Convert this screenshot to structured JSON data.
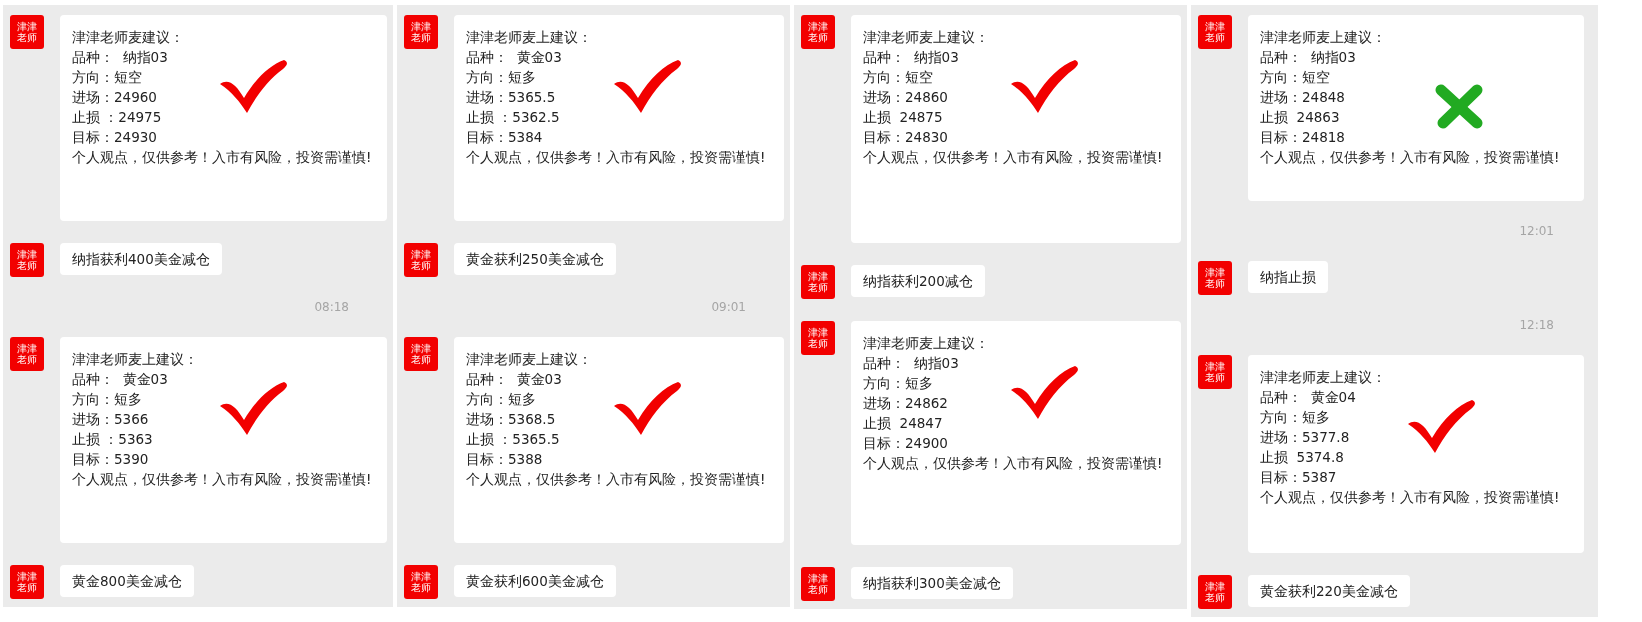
{
  "panels": [
    {
      "items": [
        {
          "kind": "advice",
          "avatar": "津津老师",
          "lines": [
            "津津老师麦建议：",
            "品种：  纳指03",
            "方向：短空",
            "进场：24960",
            "止损 ：24975",
            "目标：24930",
            "个人观点，仅供参考！入市有风险，投资需谨慎!"
          ],
          "correct": true
        },
        {
          "kind": "message",
          "avatar": "津津老师",
          "text": "纳指获利400美金减仓"
        },
        {
          "kind": "time",
          "text": "08:18"
        },
        {
          "kind": "advice",
          "avatar": "津津老师",
          "lines": [
            "津津老师麦上建议：",
            "品种：  黄金03",
            "方向：短多",
            "进场：5366",
            "止损 ：5363",
            "目标：5390",
            "个人观点，仅供参考！入市有风险，投资需谨慎!"
          ],
          "correct": true
        },
        {
          "kind": "message",
          "avatar": "津津老师",
          "text": "黄金800美金减仓"
        }
      ]
    },
    {
      "items": [
        {
          "kind": "advice",
          "avatar": "津津老师",
          "lines": [
            "津津老师麦上建议：",
            "品种：  黄金03",
            "方向：短多",
            "进场：5365.5",
            "止损 ：5362.5",
            "目标：5384",
            "个人观点，仅供参考！入市有风险，投资需谨慎!"
          ],
          "correct": true
        },
        {
          "kind": "message",
          "avatar": "津津老师",
          "text": "黄金获利250美金减仓"
        },
        {
          "kind": "time",
          "text": "09:01"
        },
        {
          "kind": "advice",
          "avatar": "津津老师",
          "lines": [
            "津津老师麦上建议：",
            "品种：  黄金03",
            "方向：短多",
            "进场：5368.5",
            "止损 ：5365.5",
            "目标：5388",
            "个人观点，仅供参考！入市有风险，投资需谨慎!"
          ],
          "correct": true
        },
        {
          "kind": "message",
          "avatar": "津津老师",
          "text": "黄金获利600美金减仓"
        }
      ]
    },
    {
      "items": [
        {
          "kind": "advice",
          "avatar": "津津老师",
          "lines": [
            "津津老师麦上建议：",
            "品种：  纳指03",
            "方向：短空",
            "进场：24860",
            "止损  24875",
            "目标：24830",
            "个人观点，仅供参考！入市有风险，投资需谨慎!"
          ],
          "correct": true
        },
        {
          "kind": "message",
          "avatar": "津津老师",
          "text": "纳指获利200减仓"
        },
        {
          "kind": "advice",
          "avatar": "津津老师",
          "lines": [
            "津津老师麦上建议：",
            "品种：  纳指03",
            "方向：短多",
            "进场：24862",
            "止损  24847",
            "目标：24900",
            "个人观点，仅供参考！入市有风险，投资需谨慎!"
          ],
          "correct": true
        },
        {
          "kind": "message",
          "avatar": "津津老师",
          "text": "纳指获利300美金减仓"
        }
      ]
    },
    {
      "items": [
        {
          "kind": "advice",
          "avatar": "津津老师",
          "lines": [
            "津津老师麦上建议：",
            "品种：  纳指03",
            "方向：短空",
            "进场：24848",
            "止损  24863",
            "目标：24818",
            "个人观点，仅供参考！入市有风险，投资需谨慎!"
          ],
          "correct": false
        },
        {
          "kind": "time",
          "text": "12:01"
        },
        {
          "kind": "message",
          "avatar": "津津老师",
          "text": "纳指止损"
        },
        {
          "kind": "time",
          "text": "12:18"
        },
        {
          "kind": "advice",
          "avatar": "津津老师",
          "lines": [
            "津津老师麦上建议：",
            "品种：  黄金04",
            "方向：短多",
            "进场：5377.8",
            "止损  5374.8",
            "目标：5387",
            "个人观点，仅供参考！入市有风险，投资需谨慎!"
          ],
          "correct": true
        },
        {
          "kind": "message",
          "avatar": "津津老师",
          "text": "黄金获利220美金减仓"
        }
      ]
    }
  ]
}
